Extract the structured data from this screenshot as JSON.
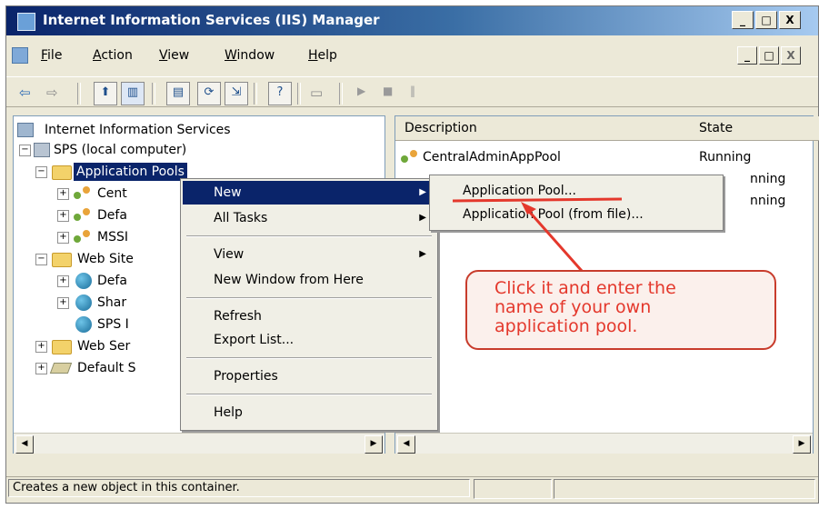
{
  "window": {
    "title": "Internet Information Services (IIS) Manager",
    "caption_buttons": [
      "_",
      "□",
      "X"
    ],
    "mdi_buttons": [
      "_",
      "□",
      "X"
    ]
  },
  "menubar": {
    "items": [
      {
        "label": "File",
        "mnemonic": "F",
        "rest": "ile"
      },
      {
        "label": "Action",
        "mnemonic": "A",
        "rest": "ction"
      },
      {
        "label": "View",
        "mnemonic": "V",
        "rest": "iew"
      },
      {
        "label": "Window",
        "mnemonic": "W",
        "rest": "indow"
      },
      {
        "label": "Help",
        "mnemonic": "H",
        "rest": "elp"
      }
    ]
  },
  "toolbar": {
    "buttons": [
      "back-icon",
      "forward-icon",
      "up-folder-icon",
      "show-hide-tree-icon",
      "properties-icon",
      "refresh-icon",
      "export-list-icon",
      "help-icon",
      "computer-icon",
      "play-icon",
      "stop-icon",
      "pause-icon"
    ]
  },
  "tree": {
    "root": "Internet Information Services",
    "computer": "SPS (local computer)",
    "app_pools": "Application Pools",
    "pool_items": [
      "Cent",
      "Defa",
      "MSSI"
    ],
    "web_sites": "Web Site",
    "site_items": [
      "Defa",
      "Shar",
      "SPS I"
    ],
    "web_ext": "Web Ser",
    "default_smtp": "Default S"
  },
  "list": {
    "columns": [
      "Description",
      "State"
    ],
    "rows": [
      {
        "description": "CentralAdminAppPool",
        "state": "Running"
      },
      {
        "description": "",
        "state": "nning"
      },
      {
        "description": "",
        "state": "nning"
      }
    ]
  },
  "context_menu": {
    "items": [
      {
        "label": "New",
        "submenu": true
      },
      {
        "label": "All Tasks",
        "submenu": true
      },
      {
        "label": "View",
        "submenu": true
      },
      {
        "label": "New Window from Here",
        "submenu": false
      },
      {
        "label": "Refresh",
        "submenu": false
      },
      {
        "label": "Export List...",
        "submenu": false
      },
      {
        "label": "Properties",
        "submenu": false
      },
      {
        "label": "Help",
        "submenu": false
      }
    ]
  },
  "submenu": {
    "items": [
      "Application Pool...",
      "Application Pool (from file)..."
    ]
  },
  "annotation": {
    "lines": [
      "Click it and enter the",
      "name of your own",
      "application pool."
    ]
  },
  "status": {
    "text": "Creates a new object in this container."
  },
  "colors": {
    "title_start": "#0a246a",
    "title_end": "#a6caf0",
    "menu_highlight": "#0a246a",
    "callout_red": "#e4382c",
    "chrome": "#ece9d8"
  }
}
